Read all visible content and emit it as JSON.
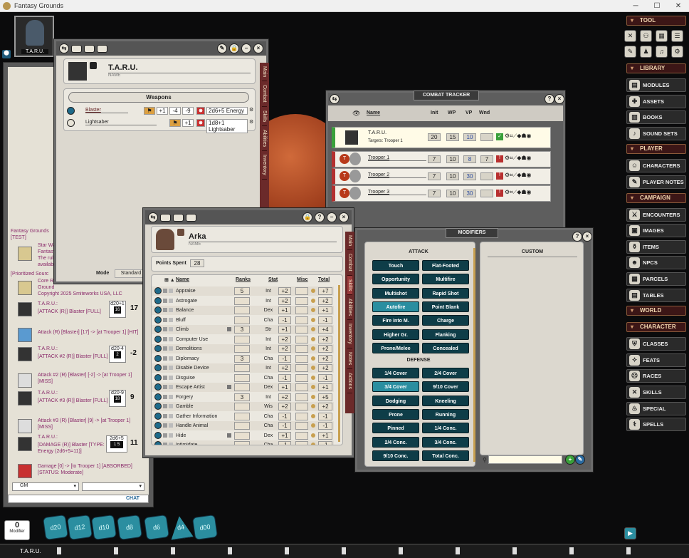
{
  "window": {
    "title": "Fantasy Grounds"
  },
  "portrait": {
    "name": "T.A.R.U."
  },
  "charsheet_taru": {
    "name": "T.A.R.U.",
    "name_label": "NAME",
    "weapons_header": "Weapons",
    "weapons": [
      {
        "name": "Blaster",
        "atk": "+1",
        "b1": "-4",
        "b2": "-9",
        "damage": "2d6+5 Energy"
      },
      {
        "name": "Lightsaber",
        "atk": "+1",
        "damage": "1d8+1 Lightsaber"
      }
    ],
    "mode_label": "Mode",
    "mode_value": "Standard",
    "tabs": [
      "Main",
      "Combat",
      "Skills",
      "Abilities",
      "Inventory",
      "Notes"
    ]
  },
  "charsheet_arka": {
    "name": "Arka",
    "name_label": "NAME",
    "points_label": "Points Spent",
    "points": "28",
    "columns": [
      "Name",
      "Ranks",
      "Stat",
      "Misc",
      "Total"
    ],
    "skills": [
      {
        "name": "Appraise",
        "ranks": "5",
        "stat": "Int",
        "mod": "+2",
        "total": "+7"
      },
      {
        "name": "Astrogate",
        "ranks": "",
        "stat": "Int",
        "mod": "+2",
        "total": "+2"
      },
      {
        "name": "Balance",
        "ranks": "",
        "stat": "Dex",
        "mod": "+1",
        "total": "+1"
      },
      {
        "name": "Bluff",
        "ranks": "",
        "stat": "Cha",
        "mod": "-1",
        "total": "-1"
      },
      {
        "name": "Climb",
        "ranks": "3",
        "stat": "Str",
        "mod": "+1",
        "total": "+4"
      },
      {
        "name": "Computer Use",
        "ranks": "",
        "stat": "Int",
        "mod": "+2",
        "total": "+2"
      },
      {
        "name": "Demolitions",
        "ranks": "",
        "stat": "Int",
        "mod": "+2",
        "total": "+2"
      },
      {
        "name": "Diplomacy",
        "ranks": "3",
        "stat": "Cha",
        "mod": "-1",
        "total": "+2"
      },
      {
        "name": "Disable Device",
        "ranks": "",
        "stat": "Int",
        "mod": "+2",
        "total": "+2"
      },
      {
        "name": "Disguise",
        "ranks": "",
        "stat": "Cha",
        "mod": "-1",
        "total": "-1"
      },
      {
        "name": "Escape Artist",
        "ranks": "",
        "stat": "Dex",
        "mod": "+1",
        "total": "+1"
      },
      {
        "name": "Forgery",
        "ranks": "3",
        "stat": "Int",
        "mod": "+2",
        "total": "+5"
      },
      {
        "name": "Gamble",
        "ranks": "",
        "stat": "Wis",
        "mod": "+2",
        "total": "+2"
      },
      {
        "name": "Gather Information",
        "ranks": "",
        "stat": "Cha",
        "mod": "-1",
        "total": "-1"
      },
      {
        "name": "Handle Animal",
        "ranks": "",
        "stat": "Cha",
        "mod": "-1",
        "total": "-1"
      },
      {
        "name": "Hide",
        "ranks": "",
        "stat": "Dex",
        "mod": "+1",
        "total": "+1"
      },
      {
        "name": "Intimidate",
        "ranks": "",
        "stat": "Cha",
        "mod": "-1",
        "total": "-1"
      }
    ],
    "tabs": [
      "Main",
      "Combat",
      "Skills",
      "Abilities",
      "Inventory",
      "Notes",
      "Actions"
    ]
  },
  "combat_tracker": {
    "title": "COMBAT TRACKER",
    "columns": [
      "Name",
      "Init",
      "WP",
      "VP",
      "Wnd"
    ],
    "rows": [
      {
        "name": "T.A.R.U.",
        "targets": "Targets: Trooper 1",
        "init": "20",
        "wp": "15",
        "vp": "10",
        "wnd": "",
        "side": "friend"
      },
      {
        "name": "Trooper 1",
        "init": "7",
        "wp": "10",
        "vp": "8",
        "wnd": "7",
        "side": "foe"
      },
      {
        "name": "Trooper 2",
        "init": "7",
        "wp": "10",
        "vp": "30",
        "wnd": "",
        "side": "foe"
      },
      {
        "name": "Trooper 3",
        "init": "7",
        "wp": "10",
        "vp": "30",
        "wnd": "",
        "side": "foe"
      }
    ]
  },
  "modifiers": {
    "title": "MODIFIERS",
    "attack_header": "ATTACK",
    "defense_header": "DEFENSE",
    "custom_header": "CUSTOM",
    "attack": [
      "Touch",
      "Flat-Footed",
      "Opportunity",
      "Multifire",
      "Multishot",
      "Rapid Shot",
      "Autofire",
      "Point Blank",
      "Fire into M.",
      "Charge",
      "Higher Gr.",
      "Flanking",
      "Prone/Melee",
      "Concealed"
    ],
    "defense": [
      "1/4 Cover",
      "2/4 Cover",
      "3/4 Cover",
      "9/10 Cover",
      "Dodging",
      "Kneeling",
      "Prone",
      "Running",
      "Pinned",
      "1/4 Conc.",
      "2/4 Conc.",
      "3/4 Conc.",
      "9/10 Conc.",
      "Total Conc."
    ]
  },
  "chat": {
    "messages": [
      {
        "t": "Fantasy Grounds",
        "c": "#8a2a6a"
      },
      {
        "t": "[TEST]",
        "c": "#8a2a6a"
      },
      {
        "t": "Star Wa",
        "c": "#8a2a6a"
      },
      {
        "t": "Fantasy",
        "c": "#8a2a6a"
      },
      {
        "t": "The rule",
        "c": "#8a2a6a"
      },
      {
        "t": "availab",
        "c": "#8a2a6a"
      },
      {
        "t": "[Prioritized Sourc",
        "c": "#8a2a6a"
      },
      {
        "t": "Core RP",
        "c": "#8a2a6a"
      },
      {
        "t": "Ground",
        "c": "#8a2a6a"
      },
      {
        "t": "Copyright 2025 Smiteworks USA, LLC",
        "c": "#8a2a6a"
      }
    ],
    "rolls": [
      {
        "who": "T.A.R.U.:",
        "desc": "[ATTACK (R)] Blaster [FULL]",
        "die": "d20+1",
        "face": "16",
        "total": "17"
      },
      {
        "desc": "Attack (R) [Blaster] [17] -> [at Trooper 1] [HIT]"
      },
      {
        "who": "T.A.R.U.:",
        "desc": "[ATTACK #2 (R)] Blaster [FULL]",
        "die": "d20-4",
        "face": "2",
        "total": "-2"
      },
      {
        "desc": "Attack #2 (R) [Blaster] [-2] -> [at Trooper 1] [MISS]"
      },
      {
        "who": "T.A.R.U.:",
        "desc": "[ATTACK #3 (R)] Blaster [FULL]",
        "die": "d20-9",
        "face": "18",
        "total": "9"
      },
      {
        "desc": "Attack #3 (R) [Blaster] [9] -> [at Trooper 1] [MISS]"
      },
      {
        "who": "T.A.R.U.:",
        "desc": "[DAMAGE (R)] Blaster [TYPE: Energy (2d6+5=11)]",
        "die": "2d6+5",
        "face": "1 5",
        "total": "11"
      },
      {
        "desc": "Damage [0] -> [to Trooper 1] [ABSORBED] [STATUS: Moderate]"
      }
    ],
    "identity": "GM",
    "chat_button": "CHAT"
  },
  "modifier_box": {
    "value": "0",
    "label": "Modifier"
  },
  "dice": [
    "d20",
    "d12",
    "d10",
    "d8",
    "d6",
    "d4",
    "d00"
  ],
  "ticker": {
    "current": "T.A.R.U."
  },
  "sidebar": {
    "tool_label": "TOOL",
    "groups": [
      {
        "label": "LIBRARY",
        "items": [
          "MODULES",
          "ASSETS",
          "BOOKS",
          "SOUND SETS"
        ]
      },
      {
        "label": "PLAYER",
        "items": [
          "CHARACTERS",
          "PLAYER NOTES"
        ]
      },
      {
        "label": "CAMPAIGN",
        "items": [
          "ENCOUNTERS",
          "IMAGES",
          "ITEMS",
          "NPCS",
          "PARCELS",
          "TABLES"
        ]
      },
      {
        "label": "WORLD",
        "items": []
      },
      {
        "label": "CHARACTER",
        "items": [
          "CLASSES",
          "FEATS",
          "RACES",
          "SKILLS",
          "SPECIAL ABILITI",
          "SPELLS"
        ]
      }
    ]
  }
}
